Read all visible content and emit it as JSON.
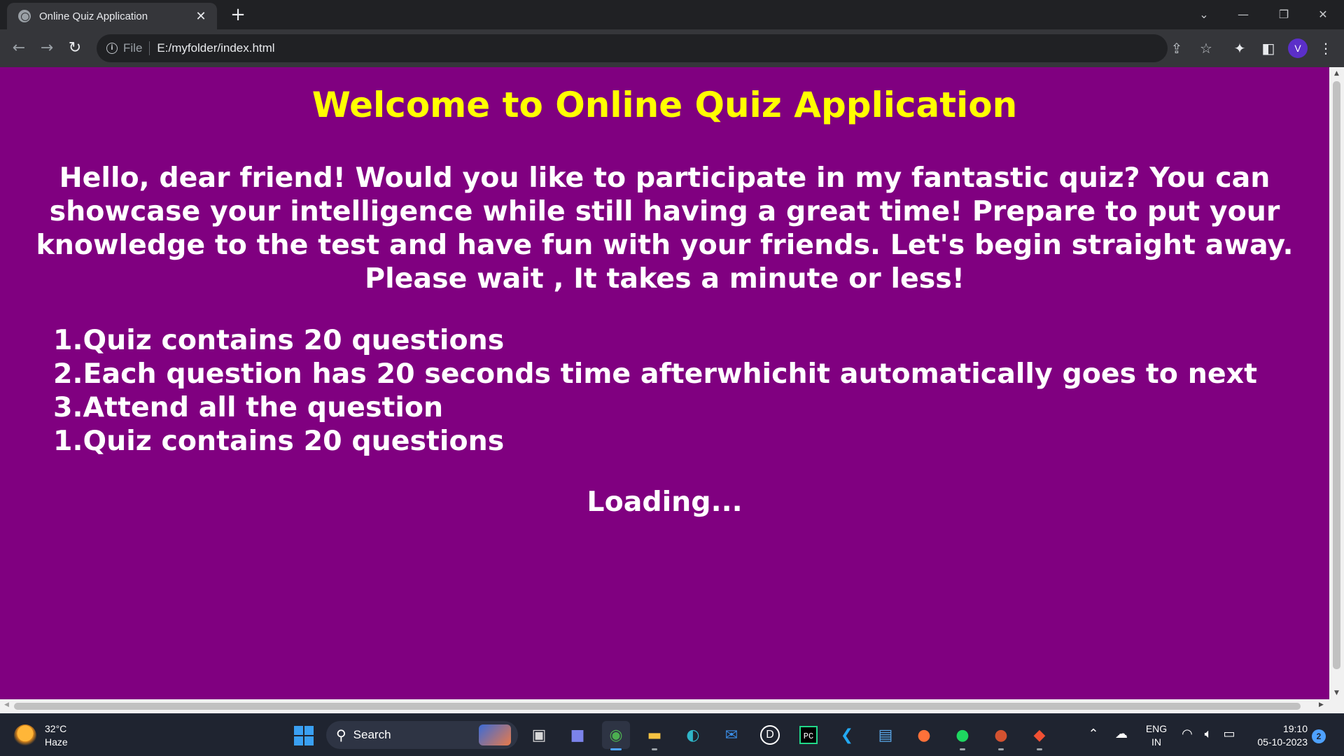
{
  "browser": {
    "tab_title": "Online Quiz Application",
    "new_tab_label": "+",
    "url_scheme": "File",
    "url": "E:/myfolder/index.html",
    "profile_initial": "V"
  },
  "page": {
    "title": "Welcome to Online Quiz Application",
    "intro": "Hello, dear friend! Would you like to participate in my fantastic quiz? You can showcase your intelligence while still having a great time! Prepare to put your knowledge to the test and have fun with your friends. Let's begin straight away. Please wait , It takes a minute or less!",
    "rules": [
      "1.Quiz contains 20 questions",
      "2.Each question has 20 seconds time afterwhichit automatically goes to next",
      "3.Attend all the question",
      "1.Quiz contains 20 questions"
    ],
    "loading": "Loading...",
    "colors": {
      "background": "#800080",
      "title": "#ffff00",
      "text": "#ffffff"
    }
  },
  "taskbar": {
    "weather_temp": "32°C",
    "weather_desc": "Haze",
    "search_label": "Search",
    "language": "ENG",
    "region": "IN",
    "time": "19:10",
    "date": "05-10-2023",
    "notification_count": "2",
    "apps": [
      "file-explorer-icon",
      "teams-icon",
      "chrome-icon",
      "folder-icon",
      "edge-icon",
      "mail-icon",
      "dell-icon",
      "pycharm-icon",
      "vscode-icon",
      "notepad-icon",
      "firefox-icon",
      "spotify-icon",
      "powerpoint-icon",
      "git-icon"
    ]
  }
}
